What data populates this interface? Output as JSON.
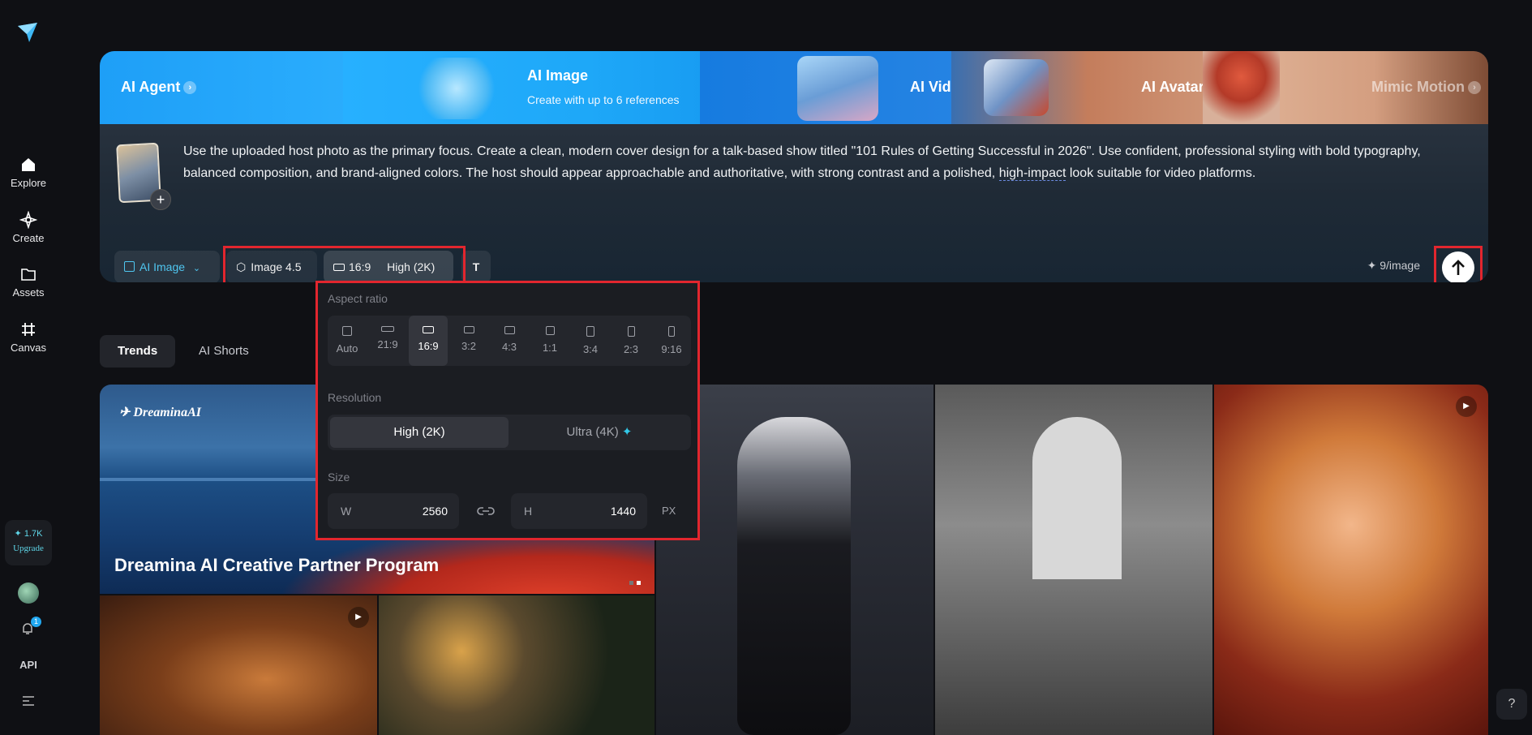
{
  "sidebar": {
    "items": [
      {
        "label": "Explore",
        "icon": "home-icon"
      },
      {
        "label": "Create",
        "icon": "sparkle-icon"
      },
      {
        "label": "Assets",
        "icon": "folder-icon"
      },
      {
        "label": "Canvas",
        "icon": "canvas-icon"
      }
    ],
    "credits": "1.7K",
    "upgrade_label": "Upgrade",
    "notification_count": "1",
    "api_label": "API"
  },
  "tabs": {
    "agent": "AI Agent",
    "image": "AI Image",
    "image_sub": "Create with up to 6 references",
    "video": "AI Video",
    "avatar": "AI Avatar",
    "mimic": "Mimic Motion"
  },
  "prompt": {
    "text_a": "Use the uploaded host photo as the primary focus. Create a clean, modern cover design for a talk-based show titled \"101 Rules of Getting Successful in 2026\". Use confident, professional styling with bold typography, balanced composition, and brand-aligned colors. The host should appear approachable and authoritative, with strong contrast and a polished, ",
    "text_underlined": "high-impact",
    "text_b": " look suitable for video platforms."
  },
  "toolbar": {
    "mode_label": "AI Image",
    "model_label": "Image 4.5",
    "ratio_label": "16:9",
    "quality_label": "High (2K)",
    "cost_label": "9/image"
  },
  "popover": {
    "aspect_label": "Aspect ratio",
    "ratios": [
      "Auto",
      "21:9",
      "16:9",
      "3:2",
      "4:3",
      "1:1",
      "3:4",
      "2:3",
      "9:16"
    ],
    "selected_ratio": "16:9",
    "resolution_label": "Resolution",
    "res_high": "High (2K)",
    "res_ultra": "Ultra (4K)",
    "size_label": "Size",
    "w_key": "W",
    "w_value": "2560",
    "h_key": "H",
    "h_value": "1440",
    "unit": "PX"
  },
  "trends": {
    "tab_trends": "Trends",
    "tab_shorts": "AI Shorts",
    "banner_logo": "DreaminaAI",
    "banner_title": "Dreamina AI Creative Partner Program"
  },
  "colors": {
    "accent": "#2fb2ff",
    "highlight_box": "#e2262e",
    "credit_cyan": "#5fd6e8"
  }
}
